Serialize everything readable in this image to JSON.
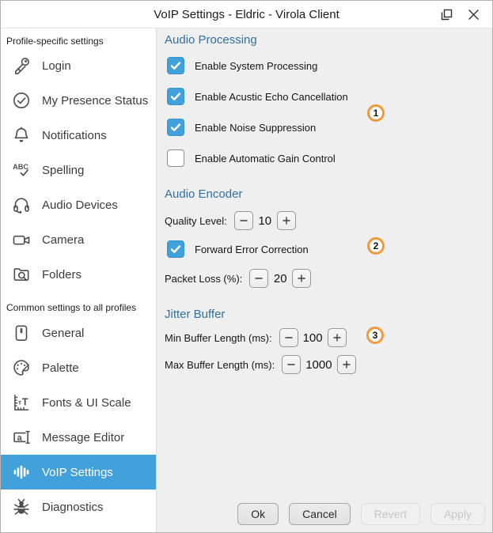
{
  "window": {
    "title": "VoIP Settings - Eldric - Virola Client"
  },
  "sidebar": {
    "section1_label": "Profile-specific settings",
    "section2_label": "Common settings to all profiles",
    "items": [
      {
        "label": "Login",
        "icon": "key-icon",
        "selected": false
      },
      {
        "label": "My Presence Status",
        "icon": "presence-check-icon",
        "selected": false
      },
      {
        "label": "Notifications",
        "icon": "bell-icon",
        "selected": false
      },
      {
        "label": "Spelling",
        "icon": "spellcheck-icon",
        "selected": false
      },
      {
        "label": "Audio Devices",
        "icon": "headset-icon",
        "selected": false
      },
      {
        "label": "Camera",
        "icon": "video-camera-icon",
        "selected": false
      },
      {
        "label": "Folders",
        "icon": "folder-search-icon",
        "selected": false
      },
      {
        "label": "General",
        "icon": "device-icon",
        "selected": false
      },
      {
        "label": "Palette",
        "icon": "palette-icon",
        "selected": false
      },
      {
        "label": "Fonts & UI Scale",
        "icon": "ruler-type-icon",
        "selected": false
      },
      {
        "label": "Message Editor",
        "icon": "text-editor-icon",
        "selected": false
      },
      {
        "label": "VoIP Settings",
        "icon": "waveform-icon",
        "selected": true
      },
      {
        "label": "Diagnostics",
        "icon": "bug-icon",
        "selected": false
      }
    ]
  },
  "content": {
    "audio_processing": {
      "title": "Audio Processing",
      "badge": "1",
      "checkboxes": [
        {
          "label": "Enable System Processing",
          "checked": true
        },
        {
          "label": "Enable Acustic Echo Cancellation",
          "checked": true
        },
        {
          "label": "Enable Noise Suppression",
          "checked": true
        },
        {
          "label": "Enable Automatic Gain Control",
          "checked": false
        }
      ]
    },
    "audio_encoder": {
      "title": "Audio Encoder",
      "badge": "2",
      "quality_level": {
        "label": "Quality Level:",
        "value": "10"
      },
      "fec_checkbox": {
        "label": "Forward Error Correction",
        "checked": true
      },
      "packet_loss": {
        "label": "Packet Loss (%):",
        "value": "20"
      }
    },
    "jitter_buffer": {
      "title": "Jitter Buffer",
      "badge": "3",
      "min_buffer": {
        "label": "Min Buffer Length (ms):",
        "value": "100"
      },
      "max_buffer": {
        "label": "Max Buffer Length (ms):",
        "value": "1000"
      }
    }
  },
  "footer": {
    "buttons": [
      {
        "label": "Ok",
        "disabled": false
      },
      {
        "label": "Cancel",
        "disabled": false
      },
      {
        "label": "Revert",
        "disabled": true
      },
      {
        "label": "Apply",
        "disabled": true
      }
    ]
  },
  "colors": {
    "accent_blue": "#42A0DA",
    "section_header_blue": "#33709F",
    "badge_orange": "#F0993D",
    "content_background": "#EFEFEF"
  }
}
